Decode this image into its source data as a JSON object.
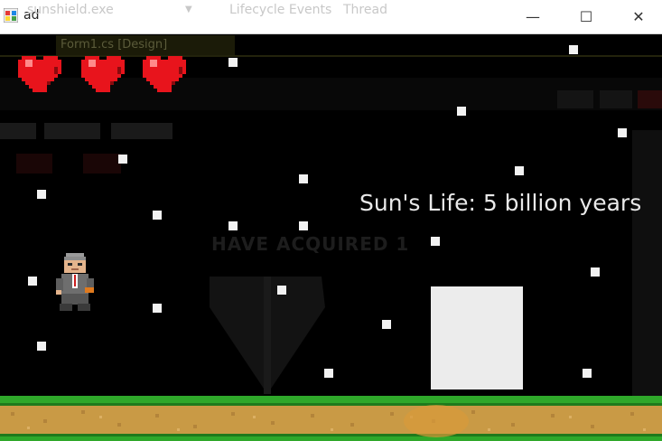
{
  "window": {
    "app_icon": "windows-forms-app-icon",
    "title": "ad",
    "ghost_process": "sunshield.exe",
    "ghost_lifecycle": "Lifecycle Events",
    "ghost_thread": "Thread",
    "minimize_icon": "minimize-icon",
    "maximize_icon": "maximize-icon",
    "close_icon": "close-icon"
  },
  "designer_ghost": {
    "tab_label": "Form1.cs [Design]",
    "banner_text": "HAVE ACQUIRED 1"
  },
  "hud": {
    "lives": 3,
    "heart_icon": "heart-icon",
    "sun_life_text": "Sun's Life: 5 billion years"
  },
  "colors": {
    "heart_red": "#e8141c",
    "heart_shadow": "#8a0a0e",
    "star_white": "#f2f2f2",
    "sun_block": "#ececec",
    "grass": "#2fa82a",
    "dirt": "#c99a45"
  },
  "game": {
    "player_icon": "player-character-icon",
    "sun_icon": "sun-block",
    "ground_icon": "grass-ground-tiles"
  }
}
